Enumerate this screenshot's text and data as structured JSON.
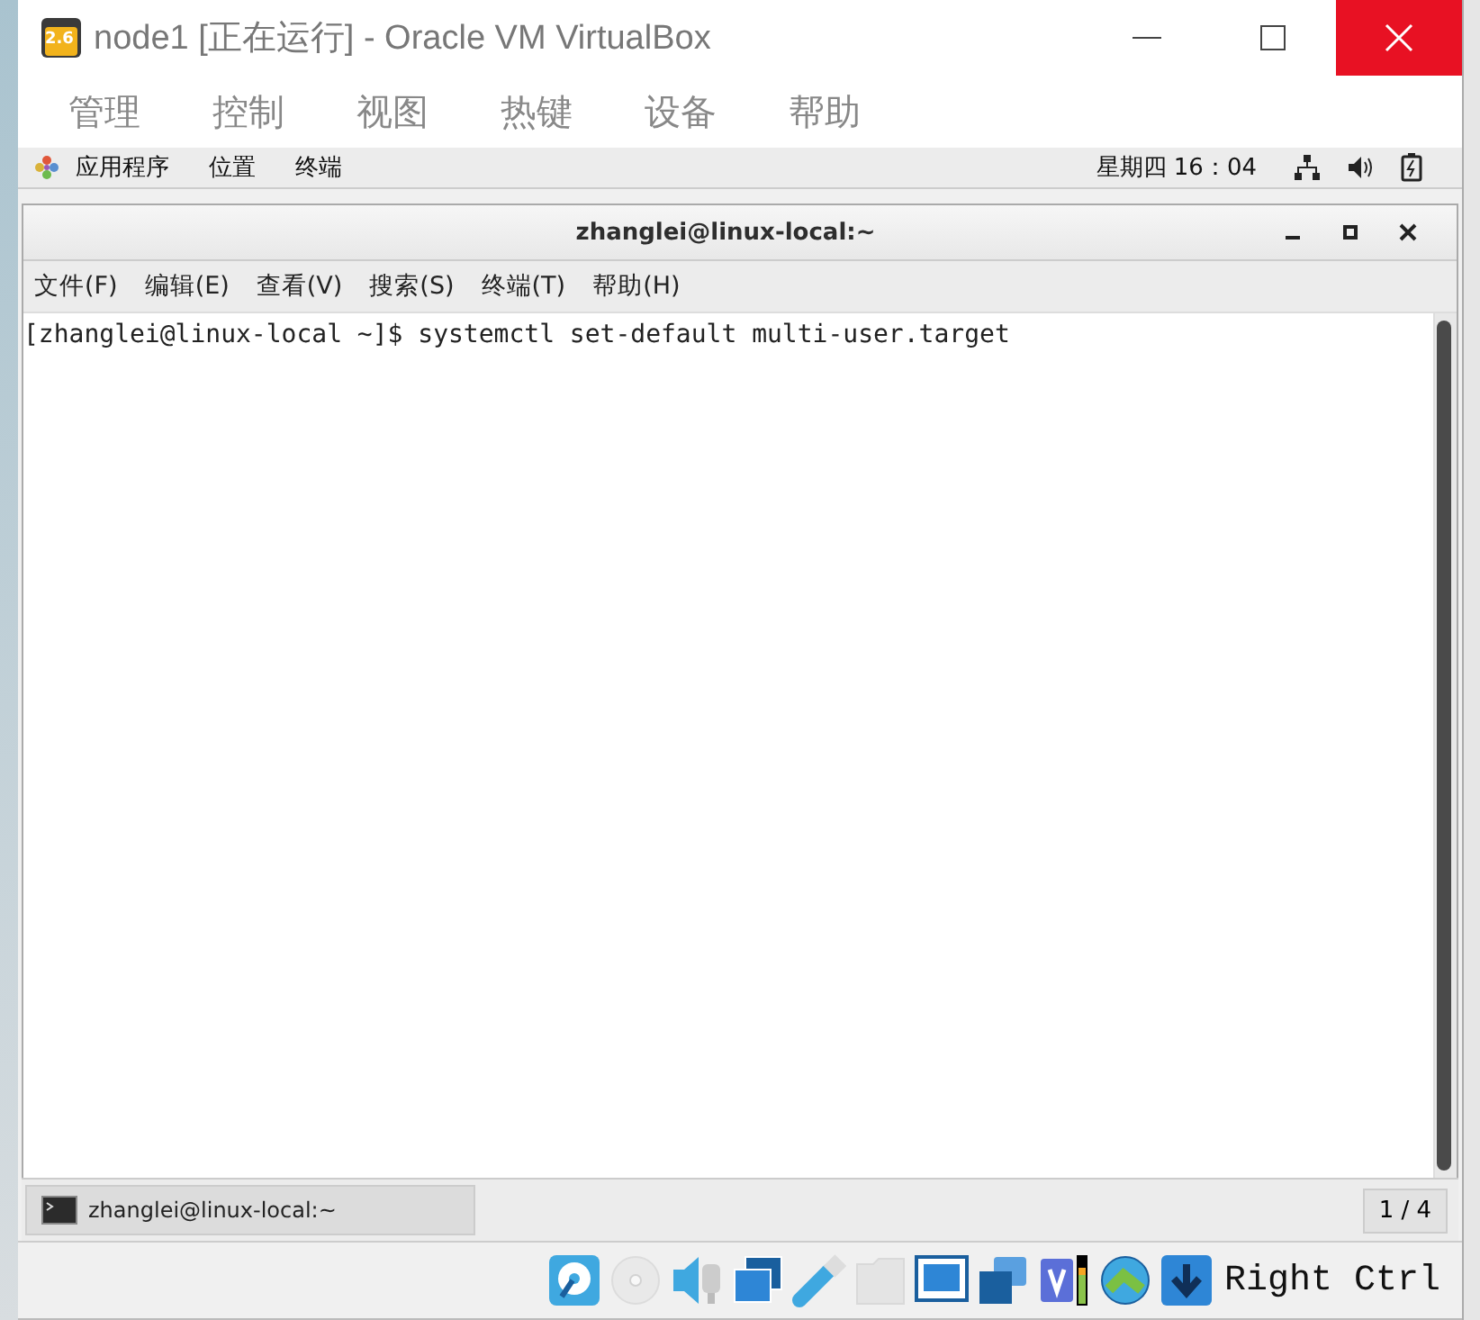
{
  "window": {
    "title": "node1 [正在运行] - Oracle VM VirtualBox",
    "badge": "2.6"
  },
  "menu": [
    "管理",
    "控制",
    "视图",
    "热键",
    "设备",
    "帮助"
  ],
  "guest_panel": {
    "items": [
      "应用程序",
      "位置",
      "终端"
    ],
    "clock": "星期四 16：04"
  },
  "terminal": {
    "title": "zhanglei@linux-local:~",
    "menu": [
      "文件(F)",
      "编辑(E)",
      "查看(V)",
      "搜索(S)",
      "终端(T)",
      "帮助(H)"
    ],
    "lines": [
      "[zhanglei@linux-local ~]$ systemctl set-default multi-user.target"
    ]
  },
  "taskbar": {
    "tasks": [
      {
        "label": "zhanglei@linux-local:~",
        "selected": true
      }
    ],
    "pager": "1 / 4"
  },
  "status_icons": [
    {
      "kind": "hard-disk",
      "disabled": false
    },
    {
      "kind": "optical",
      "disabled": true
    },
    {
      "kind": "audio",
      "disabled": false
    },
    {
      "kind": "network",
      "disabled": false
    },
    {
      "kind": "usb",
      "disabled": false
    },
    {
      "kind": "folder",
      "disabled": true
    },
    {
      "kind": "display",
      "disabled": false
    },
    {
      "kind": "capture",
      "disabled": false
    },
    {
      "kind": "cpu",
      "disabled": false
    },
    {
      "kind": "mouse",
      "disabled": false
    },
    {
      "kind": "keyboard",
      "disabled": false
    }
  ],
  "host_key": "Right Ctrl"
}
